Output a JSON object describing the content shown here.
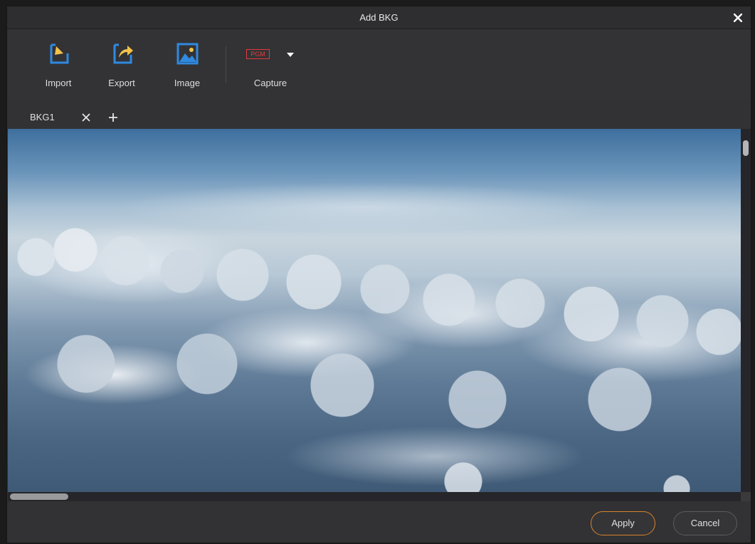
{
  "dialog": {
    "title": "Add BKG"
  },
  "toolbar": {
    "items": [
      {
        "label": "Import",
        "icon": "import-icon"
      },
      {
        "label": "Export",
        "icon": "export-icon"
      },
      {
        "label": "Image",
        "icon": "image-icon"
      },
      {
        "label": "Capture",
        "icon": "pgm-capture-icon",
        "badge": "PGM"
      }
    ]
  },
  "tabs": [
    {
      "label": "BKG1"
    }
  ],
  "buttons": {
    "apply": "Apply",
    "cancel": "Cancel"
  },
  "colors": {
    "accent_orange": "#d9822b",
    "icon_blue": "#2f8ae0",
    "icon_yellow": "#f3c24b",
    "pgm_red": "#e23b3b"
  }
}
